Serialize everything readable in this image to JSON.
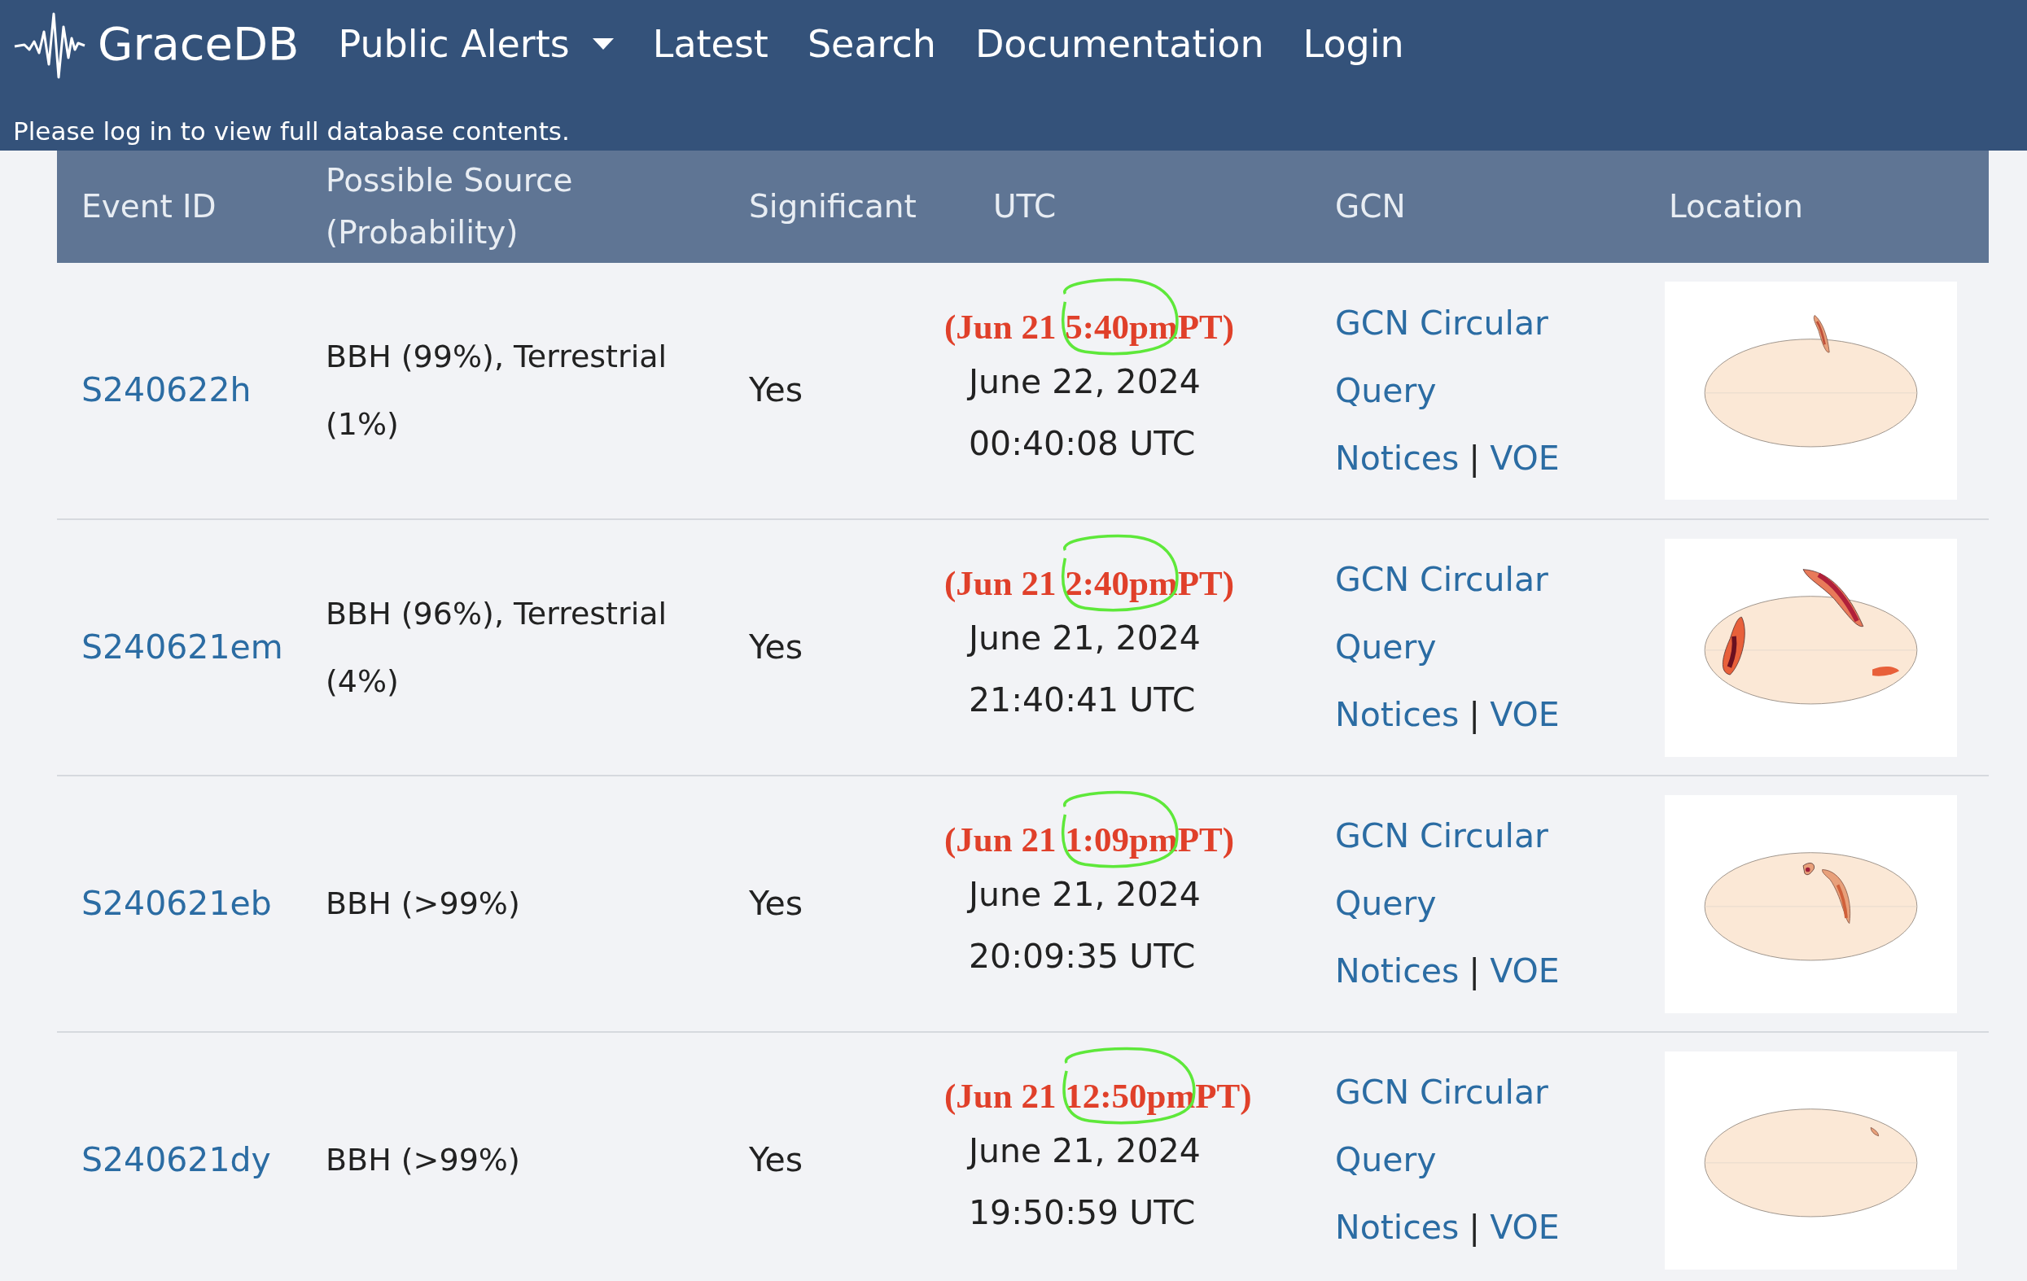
{
  "navbar": {
    "brand": "GraceDB",
    "links": [
      {
        "label": "Public Alerts",
        "dropdown": true
      },
      {
        "label": "Latest",
        "dropdown": false
      },
      {
        "label": "Search",
        "dropdown": false
      },
      {
        "label": "Documentation",
        "dropdown": false
      },
      {
        "label": "Login",
        "dropdown": false
      }
    ],
    "notice": "Please log in to view full database contents."
  },
  "table": {
    "columns": [
      "Event ID",
      "Possible Source (Probability)",
      "Significant",
      "UTC",
      "GCN",
      "Location"
    ],
    "rows": [
      {
        "event_id": "S240622h",
        "source": "BBH (99%), Terrestrial (1%)",
        "significant": "Yes",
        "note": {
          "before": "(Jun 21 ",
          "circled": "5:40pm",
          "after": "PT)"
        },
        "date": "June 22, 2024",
        "time": "00:40:08 UTC",
        "gcn": {
          "circular": "GCN Circular",
          "query": "Query",
          "notices": "Notices",
          "separator": "|",
          "voe": "VOE"
        }
      },
      {
        "event_id": "S240621em",
        "source": "BBH (96%), Terrestrial (4%)",
        "significant": "Yes",
        "note": {
          "before": "(Jun 21 ",
          "circled": "2:40pm",
          "after": "PT)"
        },
        "date": "June 21, 2024",
        "time": "21:40:41 UTC",
        "gcn": {
          "circular": "GCN Circular",
          "query": "Query",
          "notices": "Notices",
          "separator": "|",
          "voe": "VOE"
        }
      },
      {
        "event_id": "S240621eb",
        "source": "BBH (>99%)",
        "significant": "Yes",
        "note": {
          "before": "(Jun 21 ",
          "circled": "1:09pm",
          "after": "PT)"
        },
        "date": "June 21, 2024",
        "time": "20:09:35 UTC",
        "gcn": {
          "circular": "GCN Circular",
          "query": "Query",
          "notices": "Notices",
          "separator": "|",
          "voe": "VOE"
        }
      },
      {
        "event_id": "S240621dy",
        "source": "BBH (>99%)",
        "significant": "Yes",
        "note": {
          "before": "(Jun 21 ",
          "circled": "12:50pm",
          "after": "PT)"
        },
        "date": "June 21, 2024",
        "time": "19:50:59 UTC",
        "gcn": {
          "circular": "GCN Circular",
          "query": "Query",
          "notices": "Notices",
          "separator": "|",
          "voe": "VOE"
        }
      }
    ]
  }
}
